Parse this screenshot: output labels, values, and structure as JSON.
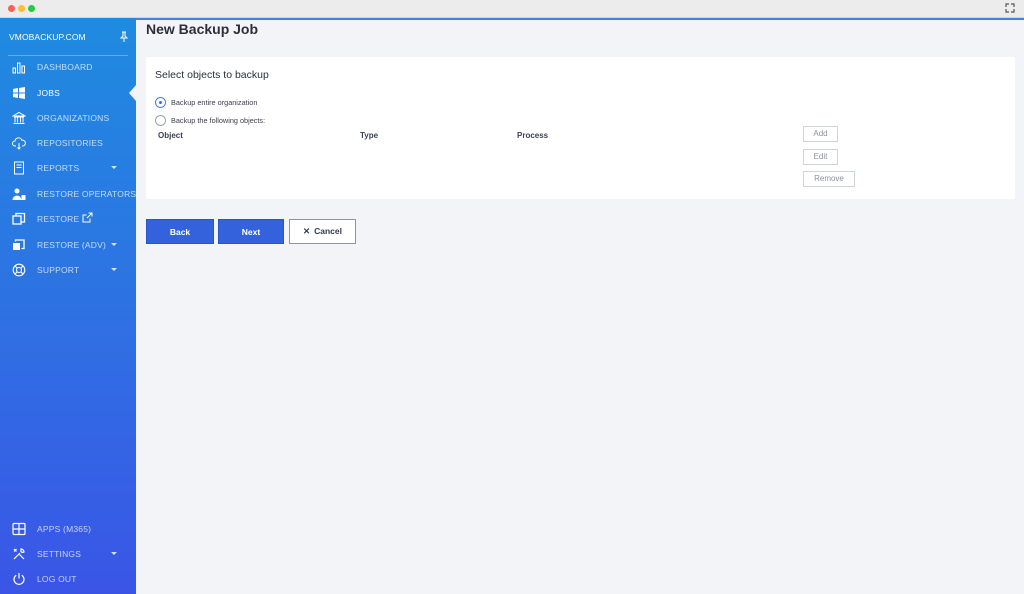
{
  "sidebar": {
    "brand": "VMOBACKUP.COM",
    "items": [
      {
        "label": "DASHBOARD",
        "icon": "bar-chart-icon"
      },
      {
        "label": "JOBS",
        "icon": "windows-icon",
        "active": true
      },
      {
        "label": "ORGANIZATIONS",
        "icon": "bank-icon"
      },
      {
        "label": "REPOSITORIES",
        "icon": "cloud-icon"
      },
      {
        "label": "REPORTS",
        "icon": "report-icon",
        "has_submenu": true
      },
      {
        "label": "RESTORE OPERATORS",
        "icon": "users-icon"
      },
      {
        "label": "RESTORE",
        "icon": "restore-icon",
        "external": true
      },
      {
        "label": "RESTORE (ADV)",
        "icon": "restore-adv-icon",
        "has_submenu": true
      },
      {
        "label": "SUPPORT",
        "icon": "lifebuoy-icon",
        "has_submenu": true
      }
    ],
    "bottom_items": [
      {
        "label": "APPS (M365)",
        "icon": "apps-grid-icon"
      },
      {
        "label": "SETTINGS",
        "icon": "tools-icon",
        "has_submenu": true
      },
      {
        "label": "LOG OUT",
        "icon": "power-icon"
      }
    ]
  },
  "main": {
    "title": "New Backup Job",
    "card": {
      "title": "Select objects to backup",
      "options": [
        {
          "label": "Backup entire organization",
          "checked": true
        },
        {
          "label": "Backup the following objects:",
          "checked": false
        }
      ],
      "columns": [
        "Object",
        "Type",
        "Process"
      ],
      "actions": [
        "Add",
        "Edit",
        "Remove"
      ]
    },
    "buttons": {
      "back": "Back",
      "next": "Next",
      "cancel": "Cancel"
    }
  },
  "colors": {
    "sidebar_top": "#1f8be0",
    "sidebar_bottom": "#3a55e6",
    "primary_button": "#3462dc",
    "page_background": "#f3f4f8"
  }
}
